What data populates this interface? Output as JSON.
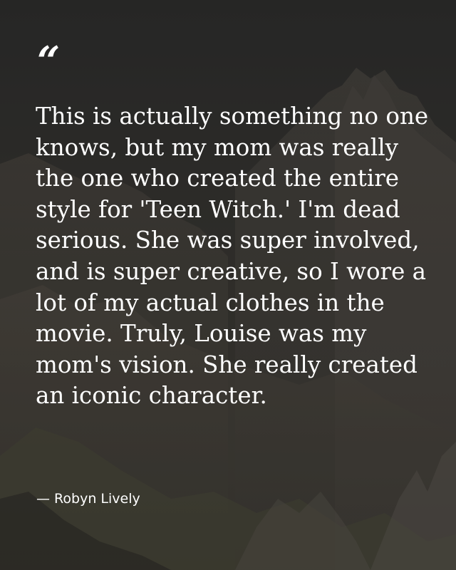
{
  "quote": {
    "mark": "“",
    "text": "This is actually something no one knows, but my mom was really the one who created the entire style for 'Teen Witch.' I'm dead serious. She was super involved, and is super creative, so I wore a lot of my actual clothes in the movie. Truly, Louise was my mom's vision. She really created an iconic character.",
    "author": "— Robyn Lively"
  },
  "colors": {
    "text": "#ffffff",
    "background": "#35332f"
  }
}
